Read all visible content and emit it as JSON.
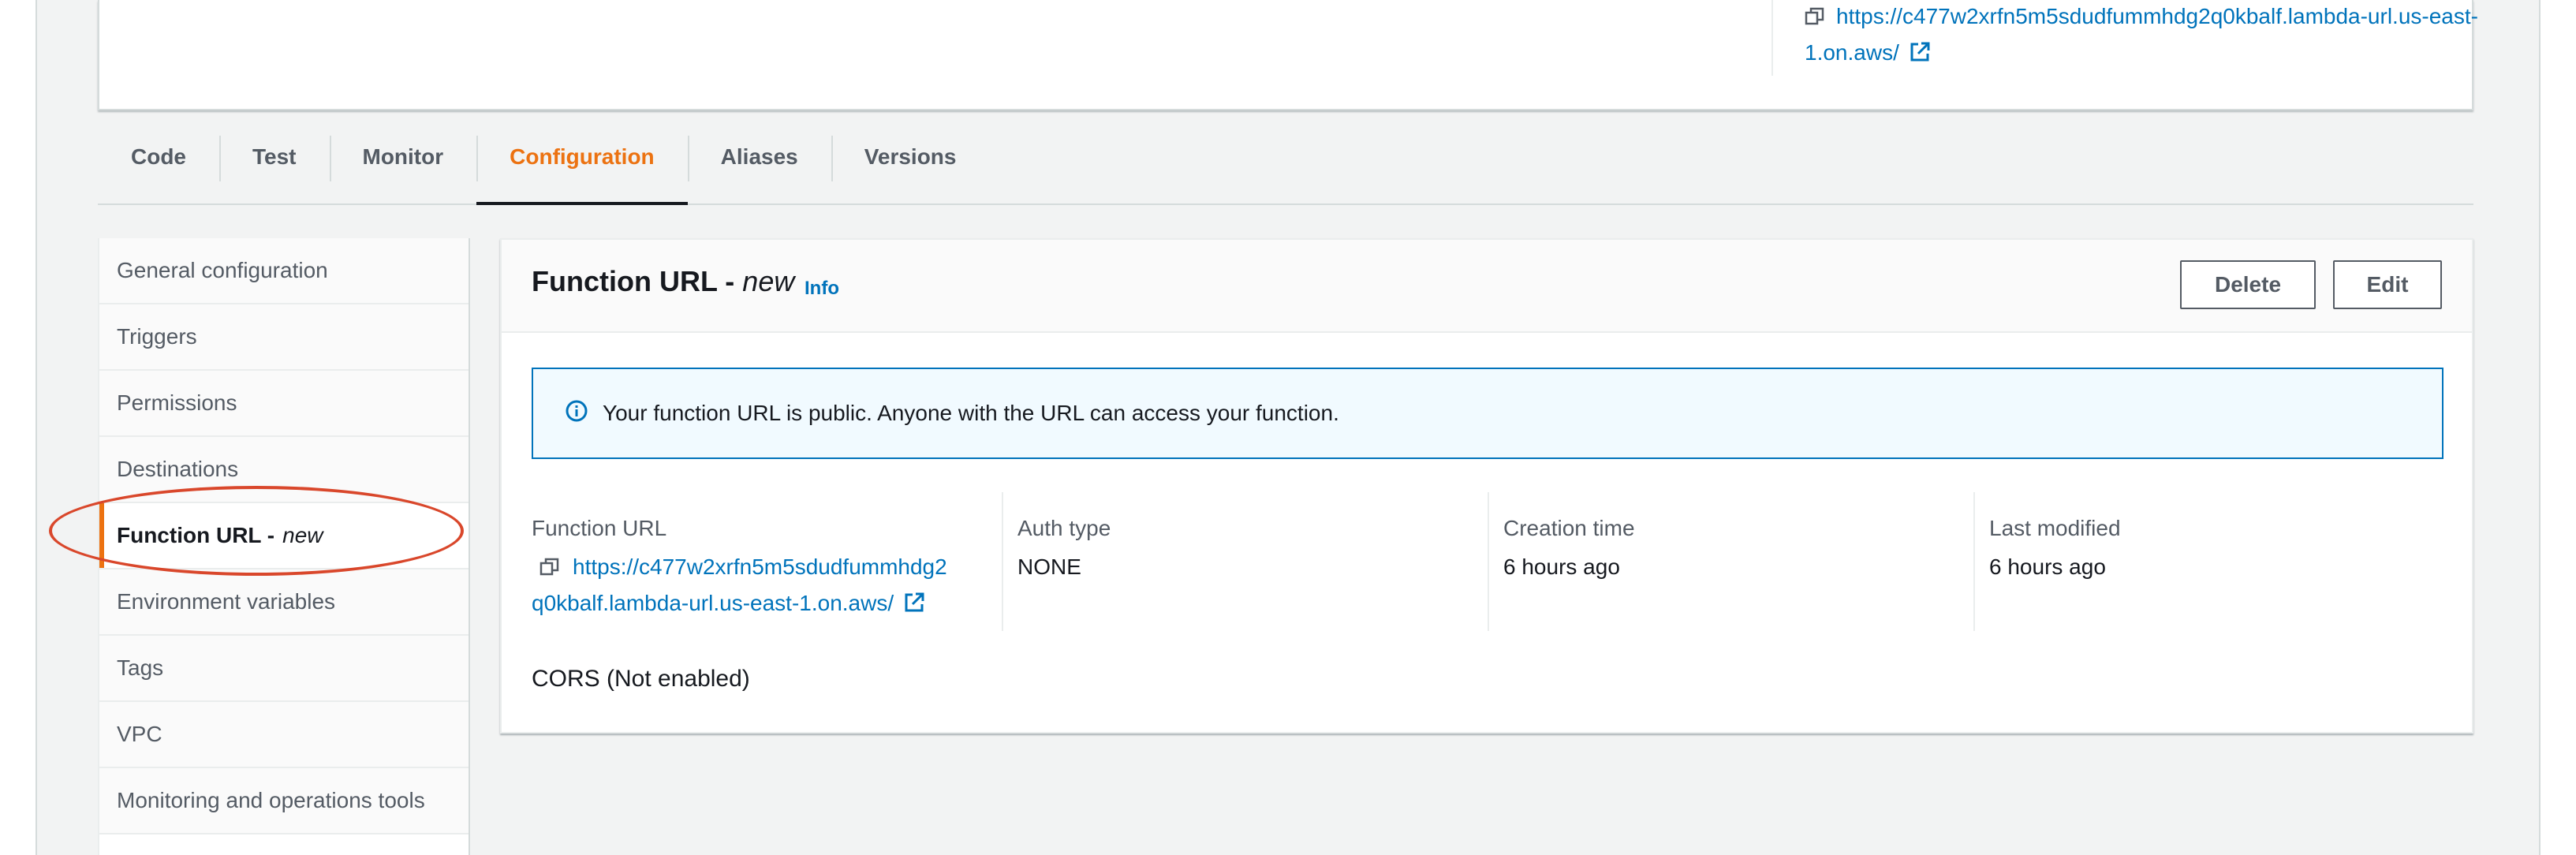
{
  "overview": {
    "function_url": "https://c477w2xrfn5m5sdudfummhdg2q0kbalf.lambda-url.us-east-1.on.aws/",
    "function_url_line1": "https://c477w2xrfn5m5sdudfummhdg2q0kbalf.lambda-url.us-east-",
    "function_url_line2": "1.on.aws/"
  },
  "tabs": [
    {
      "label": "Code",
      "active": false
    },
    {
      "label": "Test",
      "active": false
    },
    {
      "label": "Monitor",
      "active": false
    },
    {
      "label": "Configuration",
      "active": true
    },
    {
      "label": "Aliases",
      "active": false
    },
    {
      "label": "Versions",
      "active": false
    }
  ],
  "menu": {
    "items": [
      {
        "label": "General configuration"
      },
      {
        "label": "Triggers"
      },
      {
        "label": "Permissions"
      },
      {
        "label": "Destinations"
      },
      {
        "label": "Function URL -",
        "suffix": "new",
        "active": true
      },
      {
        "label": "Environment variables"
      },
      {
        "label": "Tags"
      },
      {
        "label": "VPC"
      },
      {
        "label": "Monitoring and operations tools"
      }
    ]
  },
  "panel": {
    "title": "Function URL -",
    "title_suffix": "new",
    "info_label": "Info",
    "delete_label": "Delete",
    "edit_label": "Edit",
    "alert_text": "Your function URL is public. Anyone with the URL can access your function.",
    "details": {
      "function_url_label": "Function URL",
      "function_url_line1": "https://c477w2xrfn5m5sdudfummhdg2",
      "function_url_line2": "q0kbalf.lambda-url.us-east-1.on.aws/",
      "auth_type_label": "Auth type",
      "auth_type_value": "NONE",
      "creation_time_label": "Creation time",
      "creation_time_value": "6 hours ago",
      "last_modified_label": "Last modified",
      "last_modified_value": "6 hours ago"
    },
    "cors_text": "CORS (Not enabled)"
  },
  "colors": {
    "accent_orange": "#ec7211",
    "link_blue": "#0073bb",
    "annotation_red": "#d9472b"
  }
}
